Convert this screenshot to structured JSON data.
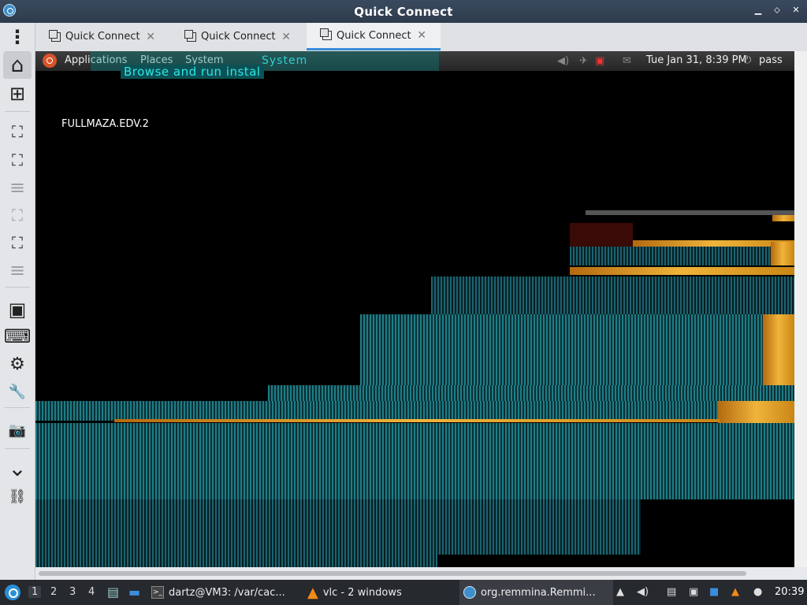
{
  "window": {
    "title": "Quick Connect",
    "min": "▁",
    "max": "⬦",
    "close": "✕"
  },
  "sidebar": {
    "items": [
      {
        "name": "menu",
        "icon": "kebab-menu-icon",
        "glyph": "⋮"
      },
      {
        "name": "home",
        "icon": "home-icon",
        "glyph": "⌂"
      },
      {
        "name": "duplicate",
        "icon": "new-connection-icon",
        "glyph": "⊞"
      },
      {
        "name": "fit-window",
        "icon": "fit-window-icon",
        "glyph": "⛶"
      },
      {
        "name": "fullscreen",
        "icon": "fullscreen-icon",
        "glyph": "⛶"
      },
      {
        "name": "menu1",
        "icon": "list-icon",
        "glyph": "≡"
      },
      {
        "name": "scale",
        "icon": "scale-icon",
        "glyph": "⛶"
      },
      {
        "name": "dynamic-resolution",
        "icon": "dynamic-resolution-icon",
        "glyph": "⛶"
      },
      {
        "name": "menu2",
        "icon": "list-icon",
        "glyph": "≡"
      },
      {
        "name": "switch-tab",
        "icon": "switch-tab-icon",
        "glyph": "▣"
      },
      {
        "name": "keyboard",
        "icon": "keyboard-icon",
        "glyph": "⌨"
      },
      {
        "name": "preferences",
        "icon": "gears-icon",
        "glyph": "⚙"
      },
      {
        "name": "tools",
        "icon": "wrench-icon",
        "glyph": "🔧"
      },
      {
        "name": "screenshot",
        "icon": "camera-icon",
        "glyph": "📷"
      },
      {
        "name": "minimize",
        "icon": "chevron-down-icon",
        "glyph": "⌄"
      },
      {
        "name": "disconnect",
        "icon": "disconnect-icon",
        "glyph": "⛓"
      }
    ]
  },
  "tabs": [
    {
      "label": "Quick Connect",
      "close": "✕"
    },
    {
      "label": "Quick Connect",
      "close": "✕"
    },
    {
      "label": "Quick Connect",
      "close": "✕"
    }
  ],
  "remote": {
    "menu": [
      "Applications",
      "Places",
      "System"
    ],
    "glitch_text": "Browse and run instal",
    "glitch_text2": "System",
    "datetime": "Tue Jan 31,  8:39 PM",
    "user": "pass",
    "desktop_label": "FULLMAZA.EDV.2"
  },
  "taskbar": {
    "workspaces": [
      "1",
      "2",
      "3",
      "4"
    ],
    "tasks": [
      {
        "label": "dartz@VM3: /var/cac..."
      },
      {
        "label": "vlc - 2 windows"
      },
      {
        "label": "org.remmina.Remmi..."
      }
    ],
    "clock": "20:39"
  },
  "colors": {
    "accent": "#3a8edb",
    "titlebar": "#2e3b4c",
    "taskbar": "#26292d",
    "aurora": "#1d7e86",
    "gold": "#f0b43a"
  }
}
